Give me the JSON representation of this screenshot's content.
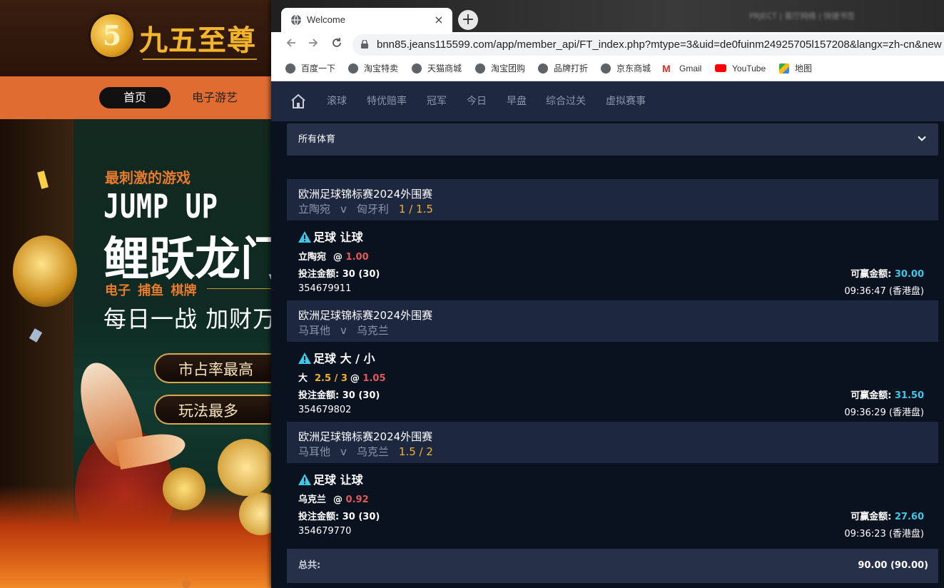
{
  "background_site": {
    "logo_number": "5",
    "logo_text": "九五至尊",
    "nav_home": "首页",
    "nav_games": "电子游艺",
    "tagline": "最刺激的游戏",
    "headline": "JUMP UP",
    "headline_cn": "鲤跃龙门",
    "categories": "电子 捕鱼 棋牌",
    "slogan": "每日一战 加财万",
    "pill_1": "市占率最高",
    "pill_2": "玩法最多"
  },
  "browser": {
    "tab_title": "Welcome",
    "tab_close": "×",
    "new_tab": "+",
    "url": "bnn85.jeans115599.com/app/member_api/FT_index.php?mtype=3&uid=de0fuinm24925705l157208&langx=zh-cn&new",
    "blurred_text": "PRJECT | 客厅网络 | 快捷书签",
    "bookmarks": [
      {
        "label": "百度一下",
        "icon": "globe-icon"
      },
      {
        "label": "淘宝特卖",
        "icon": "globe-icon"
      },
      {
        "label": "天猫商城",
        "icon": "globe-icon"
      },
      {
        "label": "淘宝团购",
        "icon": "globe-icon"
      },
      {
        "label": "品牌打折",
        "icon": "globe-icon"
      },
      {
        "label": "京东商城",
        "icon": "globe-icon"
      },
      {
        "label": "Gmail",
        "icon": "gmail-icon"
      },
      {
        "label": "YouTube",
        "icon": "youtube-icon"
      },
      {
        "label": "地图",
        "icon": "maps-icon"
      }
    ]
  },
  "topnav": {
    "items": [
      "滚球",
      "特优赔率",
      "冠军",
      "今日",
      "早盘",
      "综合过关",
      "虚拟赛事"
    ]
  },
  "sport_filter": {
    "selected": "所有体育"
  },
  "bets": [
    {
      "league": "欧洲足球锦标赛2024外围赛",
      "home": "立陶宛",
      "vs": "v",
      "away": "匈牙利",
      "line": "1 / 1.5",
      "bet_type": "足球 让球",
      "selection": "立陶宛",
      "selection_line": "",
      "at": "@",
      "odds": "1.00",
      "stake_label": "投注金额",
      "stake": "30 (30)",
      "win_label": "可赢金额",
      "win_amount": "30.00",
      "ticket_id": "354679911",
      "time": "09:36:47 (香港盘)"
    },
    {
      "league": "欧洲足球锦标赛2024外围赛",
      "home": "马耳他",
      "vs": "v",
      "away": "乌克兰",
      "line": "",
      "bet_type": "足球 大 / 小",
      "selection": "大",
      "selection_line": "2.5 / 3",
      "at": "@",
      "odds": "1.05",
      "stake_label": "投注金额",
      "stake": "30 (30)",
      "win_label": "可赢金额",
      "win_amount": "31.50",
      "ticket_id": "354679802",
      "time": "09:36:29 (香港盘)"
    },
    {
      "league": "欧洲足球锦标赛2024外围赛",
      "home": "马耳他",
      "vs": "v",
      "away": "乌克兰",
      "line": "1.5 / 2",
      "bet_type": "足球 让球",
      "selection": "乌克兰",
      "selection_line": "",
      "at": "@",
      "odds": "0.92",
      "stake_label": "投注金额",
      "stake": "30 (30)",
      "win_label": "可赢金额",
      "win_amount": "27.60",
      "ticket_id": "354679770",
      "time": "09:36:23 (香港盘)"
    }
  ],
  "total": {
    "label": "总共:",
    "value": "90.00 (90.00)"
  },
  "colors": {
    "page_bg": "#0a1220",
    "header_bg": "#1e2840",
    "odds_red": "#e05a5a",
    "line_yellow": "#f0b429",
    "win_cyan": "#3cc8e6",
    "warn_cyan": "#3cc8e6"
  }
}
